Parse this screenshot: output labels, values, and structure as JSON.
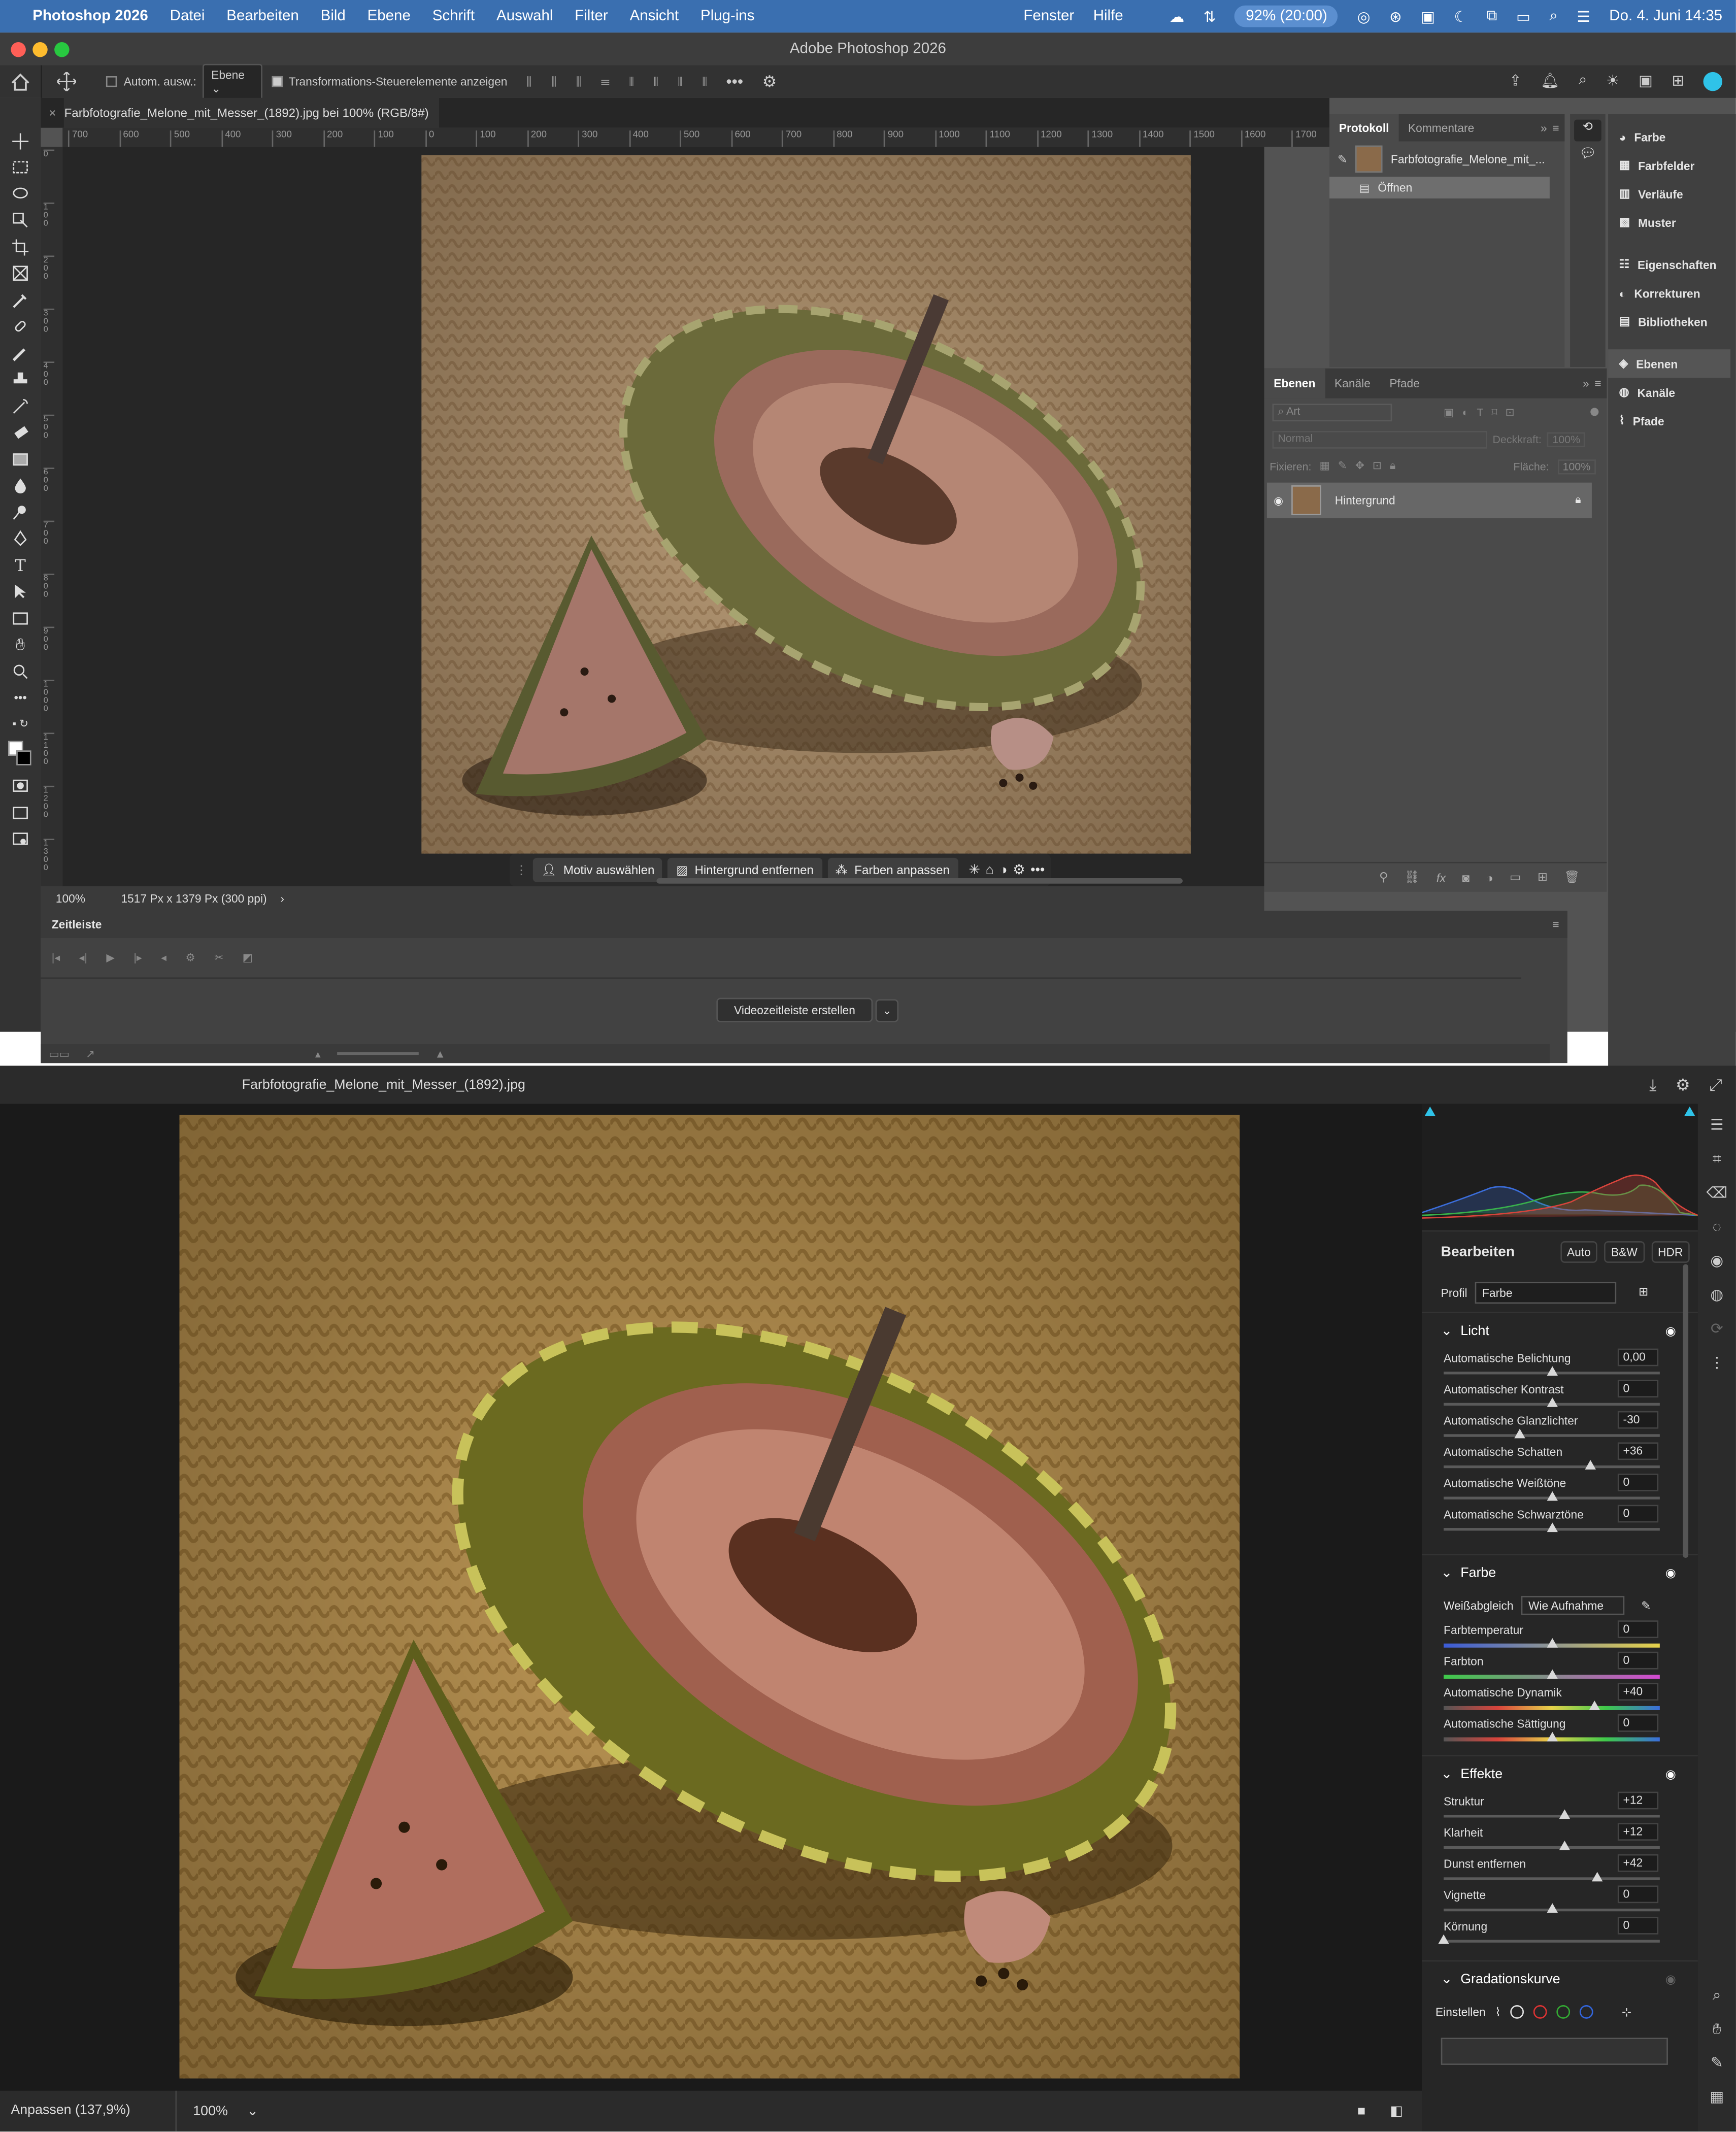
{
  "menubar": {
    "app_name": "Photoshop 2026",
    "items": [
      "Datei",
      "Bearbeiten",
      "Bild",
      "Ebene",
      "Schrift",
      "Auswahl",
      "Filter",
      "Ansicht",
      "Plug-ins"
    ],
    "right_items": [
      "Fenster",
      "Hilfe"
    ],
    "battery": "92% (20:00)",
    "datetime": "Do. 4. Juni  14:35"
  },
  "ps": {
    "window_title": "Adobe Photoshop 2026",
    "options": {
      "auto_select_label": "Autom. ausw.:",
      "auto_select_value": "Ebene",
      "transform_label": "Transformations-Steuerelemente anzeigen"
    },
    "doc_tab": "Farbfotografie_Melone_mit_Messer_(1892).jpg bei 100% (RGB/8#)",
    "ruler_top": [
      "700",
      "600",
      "500",
      "400",
      "300",
      "200",
      "100",
      "0",
      "100",
      "200",
      "300",
      "400",
      "500",
      "600",
      "700",
      "800",
      "900",
      "1000",
      "1100",
      "1200",
      "1300",
      "1400",
      "1500",
      "1600",
      "1700"
    ],
    "ruler_left": [
      "0",
      "1 0 0",
      "2 0 0",
      "3 0 0",
      "4 0 0",
      "5 0 0",
      "6 0 0",
      "7 0 0",
      "8 0 0",
      "9 0 0",
      "1 0 0 0",
      "1 1 0 0",
      "1 2 0 0",
      "1 3 0 0"
    ],
    "contextual_bar": {
      "select_subject": "Motiv auswählen",
      "remove_bg": "Hintergrund entfernen",
      "match_colors": "Farben anpassen"
    },
    "status": {
      "zoom": "100%",
      "doc_info": "1517 Px x 1379 Px (300 ppi)"
    },
    "timeline": {
      "title": "Zeitleiste",
      "create_button": "Videozeitleiste erstellen"
    },
    "protokoll": {
      "tabs": [
        "Protokoll",
        "Kommentare"
      ],
      "snapshot_name": "Farbfotografie_Melone_mit_...",
      "history_item": "Öffnen"
    },
    "layers": {
      "tabs": [
        "Ebenen",
        "Kanäle",
        "Pfade"
      ],
      "filter_placeholder": "Art",
      "blend_mode": "Normal",
      "opacity_label": "Deckkraft:",
      "opacity_value": "100%",
      "lock_label": "Fixieren:",
      "fill_label": "Fläche:",
      "fill_value": "100%",
      "layer_name": "Hintergrund"
    },
    "dock": {
      "group1": [
        "Farbe",
        "Farbfelder",
        "Verläufe",
        "Muster"
      ],
      "group2": [
        "Eigenschaften",
        "Korrekturen",
        "Bibliotheken"
      ],
      "group3": [
        "Ebenen",
        "Kanäle",
        "Pfade"
      ]
    }
  },
  "acr": {
    "filename": "Farbfotografie_Melone_mit_Messer_(1892).jpg",
    "status_zoom_fit": "Anpassen (137,9%)",
    "status_zoom": "100%",
    "panel": {
      "title": "Bearbeiten",
      "auto": "Auto",
      "bw": "B&W",
      "hdr": "HDR",
      "profile_label": "Profil",
      "profile_value": "Farbe",
      "light": {
        "title": "Licht",
        "rows": [
          {
            "label": "Automatische Belichtung",
            "value": "0,00",
            "pos": 0.5
          },
          {
            "label": "Automatischer Kontrast",
            "value": "0",
            "pos": 0.5
          },
          {
            "label": "Automatische Glanzlichter",
            "value": "-30",
            "pos": 0.35
          },
          {
            "label": "Automatische Schatten",
            "value": "+36",
            "pos": 0.68
          },
          {
            "label": "Automatische Weißtöne",
            "value": "0",
            "pos": 0.5
          },
          {
            "label": "Automatische Schwarztöne",
            "value": "0",
            "pos": 0.5
          }
        ]
      },
      "color": {
        "title": "Farbe",
        "wb_label": "Weißabgleich",
        "wb_value": "Wie Aufnahme",
        "rows": [
          {
            "label": "Farbtemperatur",
            "value": "0",
            "pos": 0.5
          },
          {
            "label": "Farbton",
            "value": "0",
            "pos": 0.5
          },
          {
            "label": "Automatische Dynamik",
            "value": "+40",
            "pos": 0.7
          },
          {
            "label": "Automatische Sättigung",
            "value": "0",
            "pos": 0.5
          }
        ]
      },
      "effects": {
        "title": "Effekte",
        "rows": [
          {
            "label": "Struktur",
            "value": "+12",
            "pos": 0.56
          },
          {
            "label": "Klarheit",
            "value": "+12",
            "pos": 0.56
          },
          {
            "label": "Dunst entfernen",
            "value": "+42",
            "pos": 0.71
          },
          {
            "label": "Vignette",
            "value": "0",
            "pos": 0.5
          },
          {
            "label": "Körnung",
            "value": "0",
            "pos": 0.0
          }
        ]
      },
      "curve": {
        "title": "Gradationskurve",
        "adjust_label": "Einstellen"
      }
    }
  },
  "colors": {
    "menubar_bg": "#3a6fb0",
    "accent_cyan": "#2fc3e8"
  }
}
